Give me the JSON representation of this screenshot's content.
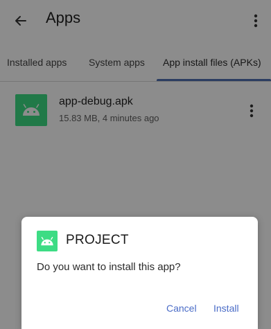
{
  "appbar": {
    "title": "Apps",
    "back_icon": "arrow-left-icon",
    "more_icon": "more-vert-icon"
  },
  "tabs": [
    {
      "label": "Installed apps",
      "selected": false
    },
    {
      "label": "System apps",
      "selected": false
    },
    {
      "label": "App install files (APKs)",
      "selected": true
    }
  ],
  "apk_list": [
    {
      "name": "app-debug.apk",
      "meta": "15.83 MB, 4 minutes ago",
      "icon": "android-icon"
    }
  ],
  "dialog": {
    "app_name": "PROJECT",
    "message": "Do you want to install this app?",
    "cancel_label": "Cancel",
    "install_label": "Install",
    "icon": "android-icon"
  },
  "colors": {
    "accent": "#4a6cc7",
    "android_green": "#3ddc84",
    "tab_indicator": "#4f6fb1"
  }
}
